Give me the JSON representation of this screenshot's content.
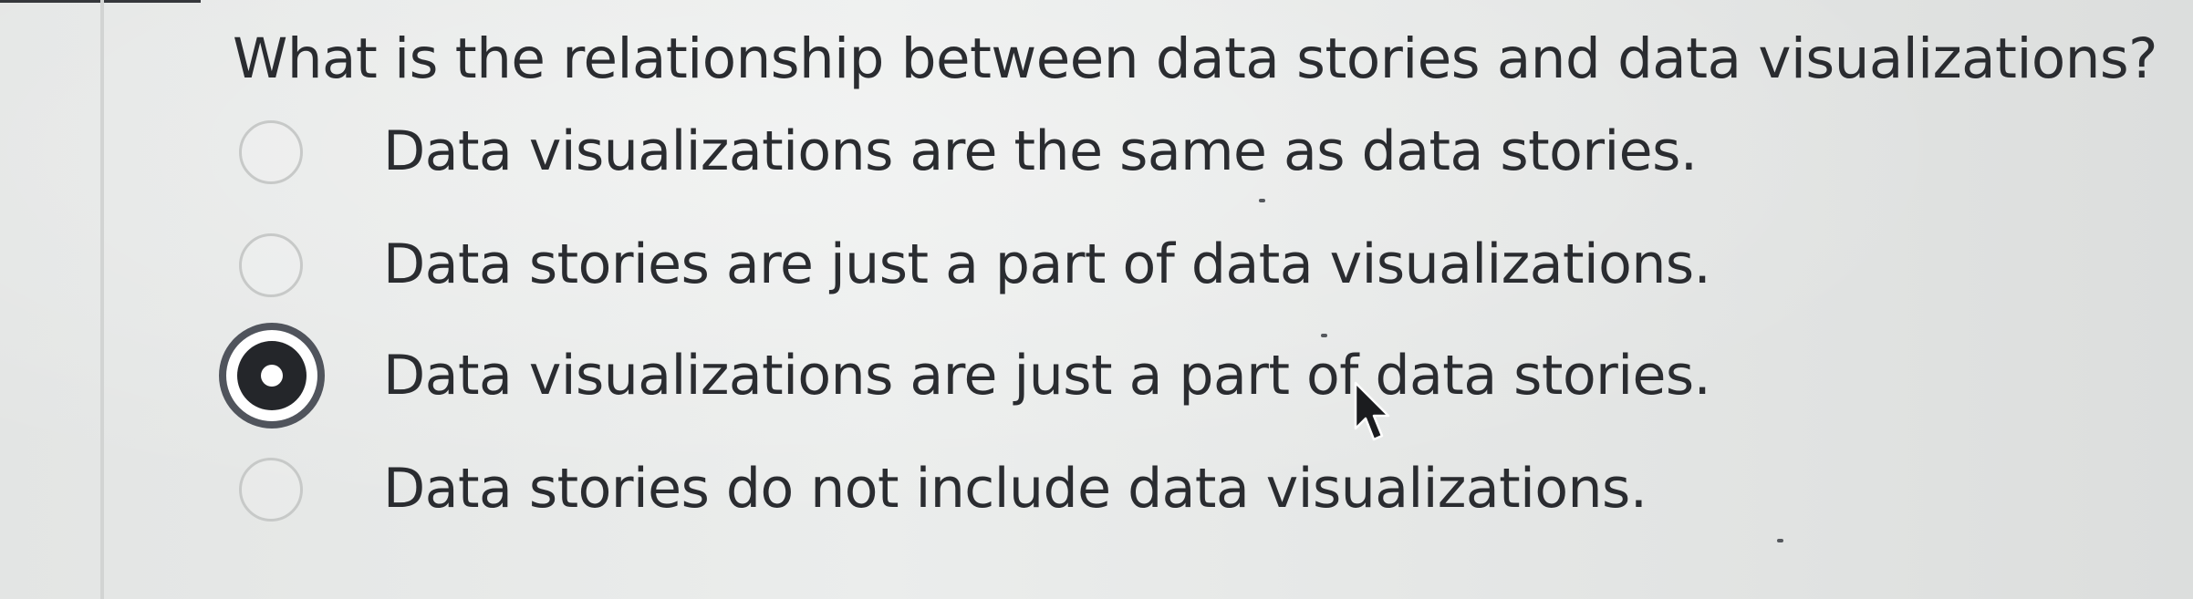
{
  "question": {
    "text": "What is the relationship between data stories and data visualizations?"
  },
  "options": [
    {
      "label": "Data visualizations are the same as data stories.",
      "selected": false
    },
    {
      "label": "Data stories are just a part of data visualizations.",
      "selected": false
    },
    {
      "label": "Data visualizations are just a part of data stories.",
      "selected": true
    },
    {
      "label": "Data stories do not include data visualizations.",
      "selected": false
    }
  ],
  "colors": {
    "background": "#e6e8e7",
    "text": "#2a2c30",
    "radio_border": "#c7c9c8",
    "radio_selected_ring": "#50545c",
    "radio_selected_fill": "#24262a"
  },
  "icons": {
    "cursor": "mouse-pointer-icon"
  }
}
